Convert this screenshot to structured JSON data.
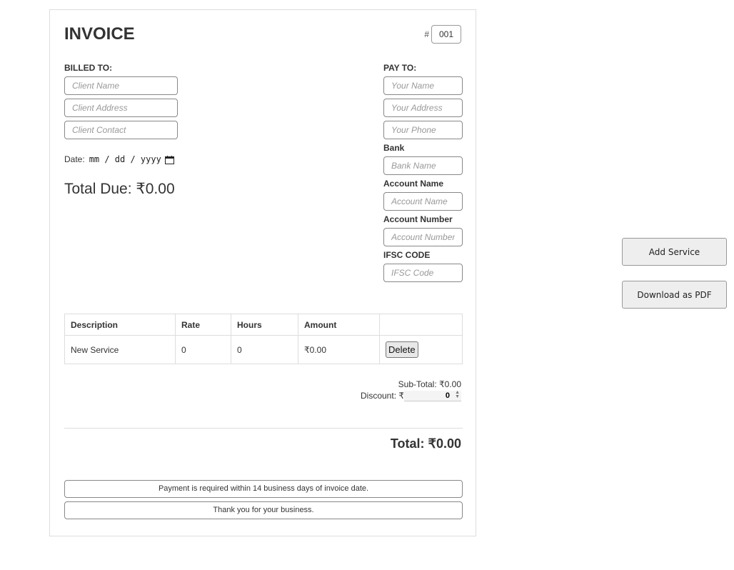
{
  "invoice": {
    "title": "INVOICE",
    "number_prefix": "#",
    "number_value": "001",
    "billed_to": {
      "heading": "BILLED TO:",
      "client_name_placeholder": "Client Name",
      "client_address_placeholder": "Client Address",
      "client_contact_placeholder": "Client Contact"
    },
    "date": {
      "label": "Date:",
      "placeholder_text": "mm / dd / yyyy"
    },
    "total_due": "Total Due: ₹0.00",
    "pay_to": {
      "heading": "PAY TO:",
      "name_placeholder": "Your Name",
      "address_placeholder": "Your Address",
      "phone_placeholder": "Your Phone",
      "bank_label": "Bank",
      "bank_placeholder": "Bank Name",
      "account_name_label": "Account Name",
      "account_name_placeholder": "Account Name",
      "account_number_label": "Account Number",
      "account_number_placeholder": "Account Number",
      "ifsc_label": "IFSC CODE",
      "ifsc_placeholder": "IFSC Code"
    },
    "table": {
      "headers": [
        "Description",
        "Rate",
        "Hours",
        "Amount",
        ""
      ],
      "rows": [
        {
          "description": "New Service",
          "rate": "0",
          "hours": "0",
          "amount": "₹0.00",
          "action": "Delete"
        }
      ]
    },
    "subtotal": "Sub-Total: ₹0.00",
    "discount_label": "Discount: ₹",
    "discount_value": "0",
    "grand_total": "Total: ₹0.00",
    "notes": [
      "Payment is required within 14 business days of invoice date.",
      "Thank you for your business."
    ]
  },
  "actions": {
    "add_service": "Add Service",
    "download_pdf": "Download as PDF"
  }
}
